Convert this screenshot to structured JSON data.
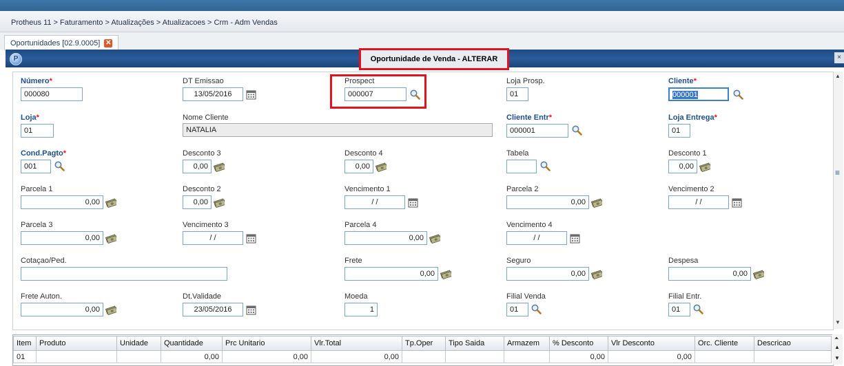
{
  "breadcrumb": "Protheus 11 > Faturamento > Atualizações > Atualizacoes > Crm - Adm Vendas",
  "tab": {
    "label": "Oportunidades [02.9.0005]"
  },
  "window": {
    "title": "Oportunidade de Venda - ALTERAR"
  },
  "fields": {
    "numero": {
      "label": "Número",
      "value": "000080"
    },
    "dt_emissao": {
      "label": "DT Emissao",
      "value": "13/05/2016"
    },
    "prospect": {
      "label": "Prospect",
      "value": "000007"
    },
    "loja_prosp": {
      "label": "Loja Prosp.",
      "value": "01"
    },
    "cliente": {
      "label": "Cliente",
      "value": "000001"
    },
    "loja": {
      "label": "Loja",
      "value": "01"
    },
    "nome_cliente": {
      "label": "Nome Cliente",
      "value": "NATALIA"
    },
    "cliente_entr": {
      "label": "Cliente Entr",
      "value": "000001"
    },
    "loja_entrega": {
      "label": "Loja Entrega",
      "value": "01"
    },
    "cond_pagto": {
      "label": "Cond.Pagto",
      "value": "001"
    },
    "desconto3": {
      "label": "Desconto 3",
      "value": "0,00"
    },
    "desconto4": {
      "label": "Desconto 4",
      "value": "0,00"
    },
    "tabela": {
      "label": "Tabela",
      "value": ""
    },
    "desconto1": {
      "label": "Desconto 1",
      "value": "0,00"
    },
    "parcela1": {
      "label": "Parcela 1",
      "value": "0,00"
    },
    "desconto2": {
      "label": "Desconto 2",
      "value": "0,00"
    },
    "vencimento1": {
      "label": "Vencimento 1",
      "value": "/ /"
    },
    "parcela2": {
      "label": "Parcela 2",
      "value": "0,00"
    },
    "vencimento2": {
      "label": "Vencimento 2",
      "value": "/ /"
    },
    "parcela3": {
      "label": "Parcela 3",
      "value": "0,00"
    },
    "vencimento3": {
      "label": "Vencimento 3",
      "value": "/ /"
    },
    "parcela4": {
      "label": "Parcela 4",
      "value": "0,00"
    },
    "vencimento4": {
      "label": "Vencimento 4",
      "value": "/ /"
    },
    "cotacao": {
      "label": "Cotaçao/Ped.",
      "value": ""
    },
    "frete": {
      "label": "Frete",
      "value": "0,00"
    },
    "seguro": {
      "label": "Seguro",
      "value": "0,00"
    },
    "despesa": {
      "label": "Despesa",
      "value": "0,00"
    },
    "frete_auton": {
      "label": "Frete Auton.",
      "value": "0,00"
    },
    "dt_validade": {
      "label": "Dt.Validade",
      "value": "23/05/2016"
    },
    "moeda": {
      "label": "Moeda",
      "value": "1"
    },
    "filial_venda": {
      "label": "Filial Venda",
      "value": "01"
    },
    "filial_entr": {
      "label": "Filial Entr.",
      "value": "01"
    }
  },
  "grid": {
    "headers": [
      "Item",
      "Produto",
      "Unidade",
      "Quantidade",
      "Prc Unitario",
      "Vlr.Total",
      "Tp.Oper",
      "Tipo Saida",
      "Armazem",
      "% Desconto",
      "Vlr Desconto",
      "Orc. Cliente",
      "Descricao"
    ],
    "rows": [
      [
        "01",
        "",
        "",
        "0,00",
        "0,00",
        "0,00",
        "",
        "",
        "",
        "0,00",
        "0,00",
        "",
        ""
      ]
    ]
  },
  "colors": {
    "highlight": "#e0141e",
    "title_bar": "#1e4a82",
    "required_label": "#1f4f8a"
  }
}
